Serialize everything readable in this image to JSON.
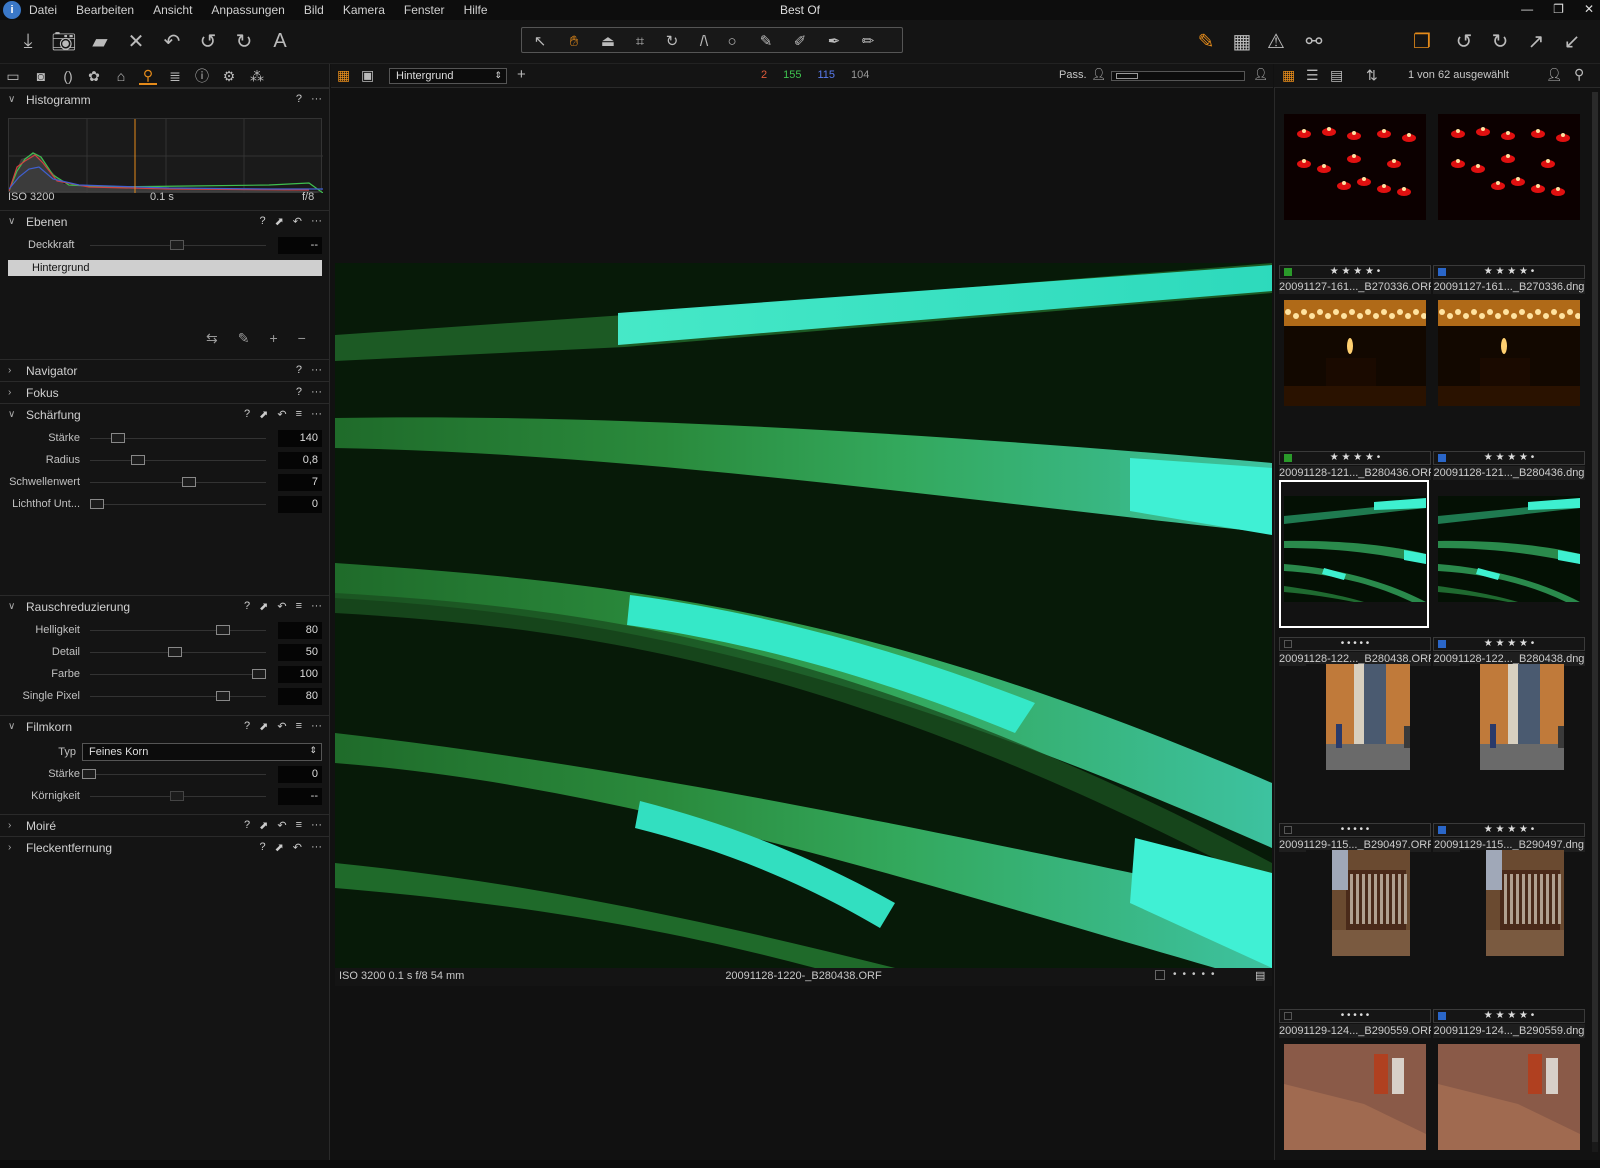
{
  "window": {
    "title": "Best Of"
  },
  "menu": [
    "Datei",
    "Bearbeiten",
    "Ansicht",
    "Anpassungen",
    "Bild",
    "Kamera",
    "Fenster",
    "Hilfe"
  ],
  "panels": {
    "histogram": {
      "title": "Histogramm",
      "iso": "ISO 3200",
      "shutter": "0.1 s",
      "aperture": "f/8"
    },
    "layers": {
      "title": "Ebenen",
      "opacity_label": "Deckkraft",
      "opacity_value": "--",
      "layer": "Hintergrund"
    },
    "navigator": {
      "title": "Navigator"
    },
    "focus": {
      "title": "Fokus"
    },
    "sharpening": {
      "title": "Schärfung",
      "rows": [
        {
          "label": "Stärke",
          "value": "140",
          "pos": 0.13
        },
        {
          "label": "Radius",
          "value": "0,8",
          "pos": 0.25
        },
        {
          "label": "Schwellenwert",
          "value": "7",
          "pos": 0.57
        },
        {
          "label": "Lichthof Unt...",
          "value": "0",
          "pos": 0.0
        }
      ]
    },
    "noise": {
      "title": "Rauschreduzierung",
      "rows": [
        {
          "label": "Helligkeit",
          "value": "80",
          "pos": 0.78
        },
        {
          "label": "Detail",
          "value": "50",
          "pos": 0.48
        },
        {
          "label": "Farbe",
          "value": "100",
          "pos": 1.0
        },
        {
          "label": "Single Pixel",
          "value": "80",
          "pos": 0.78
        }
      ]
    },
    "grain": {
      "title": "Filmkorn",
      "type_label": "Typ",
      "type_value": "Feines Korn",
      "strength_label": "Stärke",
      "strength_value": "0",
      "granularity_label": "Körnigkeit",
      "granularity_value": "--"
    },
    "moire": {
      "title": "Moiré"
    },
    "spot": {
      "title": "Fleckentfernung"
    }
  },
  "viewer": {
    "layer_select": "Hintergrund",
    "counts": [
      {
        "value": "2",
        "color": "#e05a3a"
      },
      {
        "value": "155",
        "color": "#3fc44f"
      },
      {
        "value": "115",
        "color": "#5a7cf0"
      },
      {
        "value": "104",
        "color": "#999999"
      }
    ],
    "pass_label": "Pass.",
    "status_left": "ISO 3200  0.1 s  f/8  54 mm",
    "status_center": "20091128-1220-_B280438.ORF"
  },
  "browser": {
    "selection_text": "1 von 62 ausgewählt",
    "items": [
      {
        "name": "20091127-161..._B270336.ORF",
        "stars": "★ ★ ★ ★ •",
        "tag": "#2a9a2a",
        "kind": "candles"
      },
      {
        "name": "20091127-161..._B270336.dng",
        "stars": "★ ★ ★ ★ •",
        "tag": "#2a66c8",
        "kind": "candles"
      },
      {
        "name": "20091128-121..._B280436.ORF",
        "stars": "★ ★ ★ ★ •",
        "tag": "#2a9a2a",
        "kind": "candle"
      },
      {
        "name": "20091128-121..._B280436.dng",
        "stars": "★ ★ ★ ★ •",
        "tag": "#2a66c8",
        "kind": "candle"
      },
      {
        "name": "20091128-122..._B280438.ORF",
        "stars": "• • • • •",
        "tag": "#151515",
        "kind": "green",
        "selected": true
      },
      {
        "name": "20091128-122..._B280438.dng",
        "stars": "★ ★ ★ ★ •",
        "tag": "#2a66c8",
        "kind": "green"
      },
      {
        "name": "20091129-115..._B290497.ORF",
        "stars": "• • • • •",
        "tag": "#151515",
        "kind": "alley"
      },
      {
        "name": "20091129-115..._B290497.dng",
        "stars": "★ ★ ★ ★ •",
        "tag": "#2a66c8",
        "kind": "alley"
      },
      {
        "name": "20091129-124..._B290559.ORF",
        "stars": "• • • • •",
        "tag": "#151515",
        "kind": "organ"
      },
      {
        "name": "20091129-124..._B290559.dng",
        "stars": "★ ★ ★ ★ •",
        "tag": "#2a66c8",
        "kind": "organ"
      },
      {
        "name": "",
        "stars": "",
        "tag": "",
        "kind": "wall"
      },
      {
        "name": "",
        "stars": "",
        "tag": "",
        "kind": "wall"
      }
    ]
  },
  "colors": {
    "accent": "#e58b1a"
  }
}
